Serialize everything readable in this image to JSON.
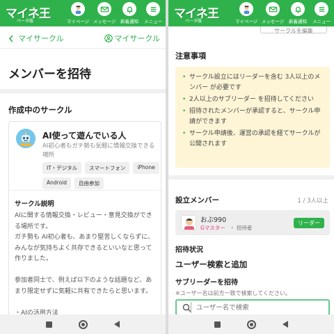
{
  "app": {
    "logo": "マイネ王",
    "logo_sub": "ベータ版",
    "nav": [
      {
        "label": "マイページ",
        "icon": "avatar-icon"
      },
      {
        "label": "メッセージ",
        "icon": "mail-icon"
      },
      {
        "label": "新着通知",
        "icon": "bell-icon"
      },
      {
        "label": "メニュー",
        "icon": "menu-icon"
      }
    ],
    "accent": "#2fb24c"
  },
  "left": {
    "back_label": "マイサークル",
    "right_link": "マイサークル",
    "page_title": "メンバーを招待",
    "section_title": "作成中のサークル",
    "circle": {
      "name": "AI使って遊んでいる人",
      "desc": "AI初心者もガチ勢も気軽に情報交換できる場所",
      "tags": [
        "IT・デジタル",
        "スマートフォン",
        "iPhone",
        "Android",
        "自由参加"
      ]
    },
    "explain_head": "サークル説明",
    "explain": [
      "AIに関する情報交換・レビュー・意見交換ができる場所です。",
      "ガチ勢も AI初心者も、あまり堅苦しくならずに、みんなが気持ちよく共存できるといいなと思って作りました。",
      "",
      "参加者同士で、例えば以下のような話題など、あまり限定せずに気軽に共有できたらと思います。",
      "",
      "・AIの活用方法"
    ]
  },
  "right": {
    "peek_button": "サークルを編集",
    "notice_title": "注意事項",
    "notices": [
      "サークル設立にはリーダーを含む 3人以上のメンバー が必要です",
      "2人以上のサブリーダー を招待してください",
      "招待されたメンバーが承認すると、サークル申請ができます",
      "サークル申請後、運営の承認を経てサークルが公開されます"
    ],
    "members_title": "設立メンバー",
    "members_count": "1 / 3人以上",
    "member": {
      "name": "おぶ990",
      "role": "Gマスター",
      "status": "招待者",
      "badge": "リーダー"
    },
    "invite_status": "招待状況",
    "search_title": "ユーザー検索と追加",
    "subleader_title": "サブリーダーを招待",
    "search_note": "※ユーザー名は前方一致で検索してください。",
    "search_placeholder": "ユーザー名で検索"
  }
}
